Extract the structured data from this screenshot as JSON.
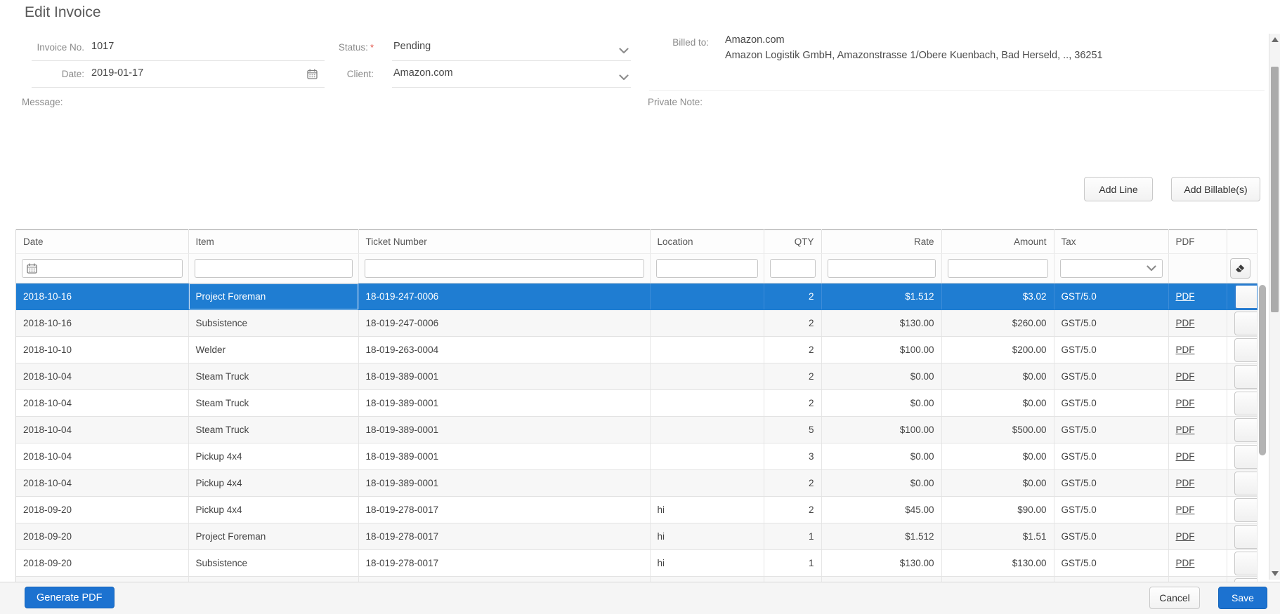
{
  "page": {
    "title": "Edit Invoice"
  },
  "form": {
    "invoice_no": {
      "label": "Invoice No.",
      "value": "1017"
    },
    "date": {
      "label": "Date:",
      "value": "2019-01-17"
    },
    "status": {
      "label": "Status:",
      "required_mark": "*",
      "value": "Pending"
    },
    "client": {
      "label": "Client:",
      "value": "Amazon.com"
    },
    "billed_to": {
      "label": "Billed to:",
      "name": "Amazon.com",
      "address": "Amazon Logistik GmbH, Amazonstrasse 1/Obere Kuenbach, Bad Herseld, .., 36251"
    },
    "message": {
      "label": "Message:"
    },
    "private_note": {
      "label": "Private Note:"
    }
  },
  "toolbar": {
    "add_line_label": "Add Line",
    "add_billables_label": "Add Billable(s)"
  },
  "footer": {
    "generate_pdf_label": "Generate PDF",
    "cancel_label": "Cancel",
    "save_label": "Save"
  },
  "table": {
    "columns": [
      "Date",
      "Item",
      "Ticket Number",
      "Location",
      "QTY",
      "Rate",
      "Amount",
      "Tax",
      "PDF"
    ],
    "pdf_link_label": "PDF",
    "filters": {
      "date": "",
      "item": "",
      "ticket": "",
      "location": "",
      "qty": "",
      "rate": "",
      "amount": "",
      "tax": ""
    },
    "rows": [
      {
        "date": "2018-10-16",
        "item": "Project Foreman",
        "ticket": "18-019-247-0006",
        "location": "",
        "qty": "2",
        "rate": "$1.512",
        "amount": "$3.02",
        "tax": "GST/5.0",
        "selected": true
      },
      {
        "date": "2018-10-16",
        "item": "Subsistence",
        "ticket": "18-019-247-0006",
        "location": "",
        "qty": "2",
        "rate": "$130.00",
        "amount": "$260.00",
        "tax": "GST/5.0"
      },
      {
        "date": "2018-10-10",
        "item": "Welder",
        "ticket": "18-019-263-0004",
        "location": "",
        "qty": "2",
        "rate": "$100.00",
        "amount": "$200.00",
        "tax": "GST/5.0"
      },
      {
        "date": "2018-10-04",
        "item": "Steam Truck",
        "ticket": "18-019-389-0001",
        "location": "",
        "qty": "2",
        "rate": "$0.00",
        "amount": "$0.00",
        "tax": "GST/5.0"
      },
      {
        "date": "2018-10-04",
        "item": "Steam Truck",
        "ticket": "18-019-389-0001",
        "location": "",
        "qty": "2",
        "rate": "$0.00",
        "amount": "$0.00",
        "tax": "GST/5.0"
      },
      {
        "date": "2018-10-04",
        "item": "Steam Truck",
        "ticket": "18-019-389-0001",
        "location": "",
        "qty": "5",
        "rate": "$100.00",
        "amount": "$500.00",
        "tax": "GST/5.0"
      },
      {
        "date": "2018-10-04",
        "item": "Pickup 4x4",
        "ticket": "18-019-389-0001",
        "location": "",
        "qty": "3",
        "rate": "$0.00",
        "amount": "$0.00",
        "tax": "GST/5.0"
      },
      {
        "date": "2018-10-04",
        "item": "Pickup 4x4",
        "ticket": "18-019-389-0001",
        "location": "",
        "qty": "2",
        "rate": "$0.00",
        "amount": "$0.00",
        "tax": "GST/5.0"
      },
      {
        "date": "2018-09-20",
        "item": "Pickup 4x4",
        "ticket": "18-019-278-0017",
        "location": "hi",
        "qty": "2",
        "rate": "$45.00",
        "amount": "$90.00",
        "tax": "GST/5.0"
      },
      {
        "date": "2018-09-20",
        "item": "Project Foreman",
        "ticket": "18-019-278-0017",
        "location": "hi",
        "qty": "1",
        "rate": "$1.512",
        "amount": "$1.51",
        "tax": "GST/5.0"
      },
      {
        "date": "2018-09-20",
        "item": "Subsistence",
        "ticket": "18-019-278-0017",
        "location": "hi",
        "qty": "1",
        "rate": "$130.00",
        "amount": "$130.00",
        "tax": "GST/5.0"
      }
    ]
  },
  "colors": {
    "selected_row": "#1f7dd2",
    "primary_button": "#1c72d0",
    "required_asterisk": "#e2574c",
    "link": "#4a4a4a"
  }
}
